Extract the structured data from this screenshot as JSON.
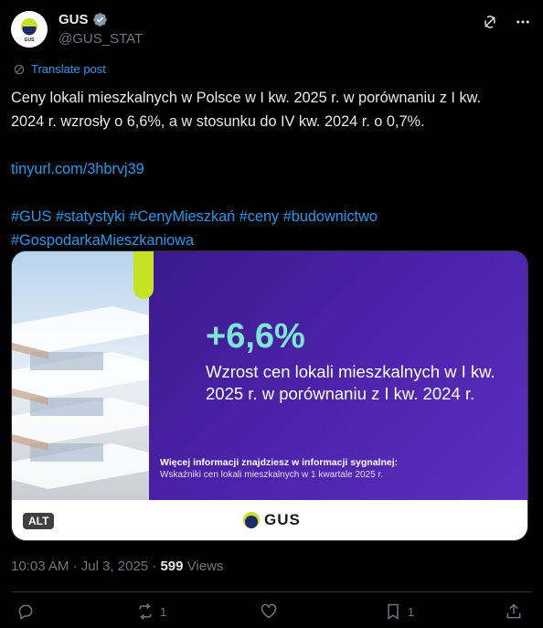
{
  "account": {
    "name": "GUS",
    "handle": "@GUS_STAT",
    "avatar_text": "GUS"
  },
  "header_icons": [
    "grok-icon",
    "more-icon"
  ],
  "translate_label": "Translate post",
  "tweet": {
    "line1": "Ceny lokali mieszkalnych w Polsce w I kw. 2025 r. w porównaniu z I kw.",
    "line2": "2024 r. wzrosły o 6,6%, a w stosunku do IV kw. 2024 r. o 0,7%.",
    "link": "tinyurl.com/3hbrvj39",
    "hashtags_line1": "#GUS #statystyki #CenyMieszkań #ceny #budownictwo",
    "hashtags_line2": "#GospodarkaMieszkaniowa"
  },
  "media": {
    "big_value": "+6,6%",
    "headline": "Wzrost cen lokali mieszkalnych w I kw. 2025 r. w porównaniu z I kw. 2024 r.",
    "small_line1": "Więcej informacji znajdziesz w informacji sygnalnej:",
    "small_line2": "Wskaźniki cen lokali mieszkalnych w 1 kwartale 2025 r.",
    "logo_text": "GUS",
    "alt_label": "ALT",
    "colors": {
      "purple": "#4a22a8",
      "teal": "#7de6d3",
      "lime": "#c6e224"
    }
  },
  "meta": {
    "time": "10:03 AM",
    "date": "Jul 3, 2025",
    "views_count": "599",
    "views_label": "Views"
  },
  "actions": {
    "replies": "",
    "reposts": "1",
    "likes": "",
    "bookmarks": "1"
  }
}
